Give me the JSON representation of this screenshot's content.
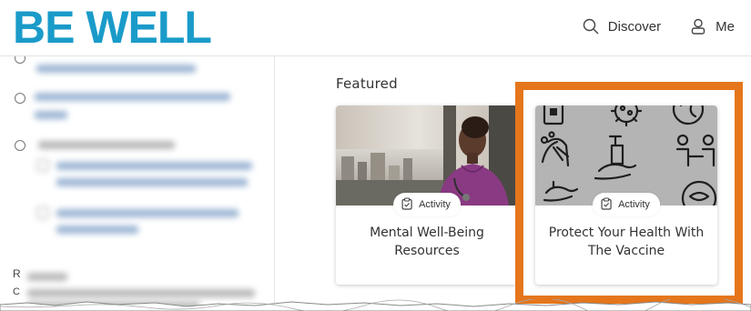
{
  "header": {
    "logo_text": "BE WELL",
    "logo_color": "#1a9bc9",
    "nav": [
      {
        "label": "Discover",
        "icon": "search-icon"
      },
      {
        "label": "Me",
        "icon": "user-icon"
      }
    ]
  },
  "sidebar": {
    "partial_label": "R",
    "partial_letter": "C",
    "blurred": true
  },
  "main": {
    "section_title": "Featured",
    "cards": [
      {
        "badge": "Activity",
        "badge_icon": "clipboard-icon",
        "title": "Mental Well-Being Resources",
        "image": "photo-nurse-at-window"
      },
      {
        "badge": "Activity",
        "badge_icon": "clipboard-icon",
        "title": "Protect Your Health With The Vaccine",
        "image": "hygiene-icons-illustration"
      }
    ]
  },
  "colors": {
    "accent": "#e5761c",
    "brand": "#1a9bc9",
    "link": "#9db6d4",
    "text": "#333333"
  }
}
